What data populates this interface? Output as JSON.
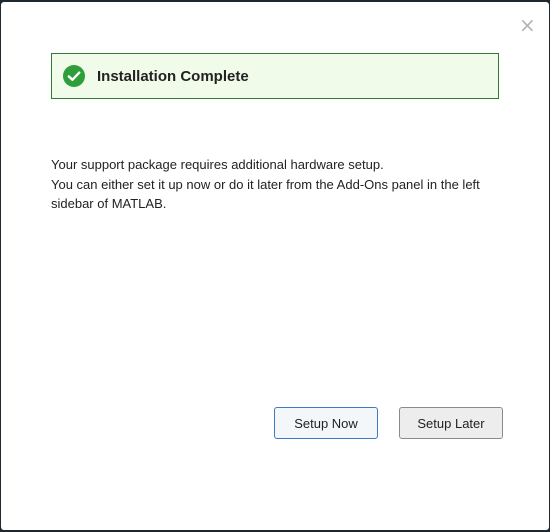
{
  "dialog": {
    "close_glyph": "×",
    "banner": {
      "title": "Installation Complete",
      "icon": "check-circle-icon",
      "accent_color": "#2e9e3a",
      "border_color": "#2e7d32",
      "background_color": "#f0fbe9"
    },
    "message": {
      "line1": "Your support package requires additional hardware setup.",
      "line2": "You can either set it up now or do it later from the Add-Ons panel in the left sidebar of MATLAB."
    },
    "buttons": {
      "setup_now_label": "Setup Now",
      "setup_later_label": "Setup Later"
    }
  }
}
